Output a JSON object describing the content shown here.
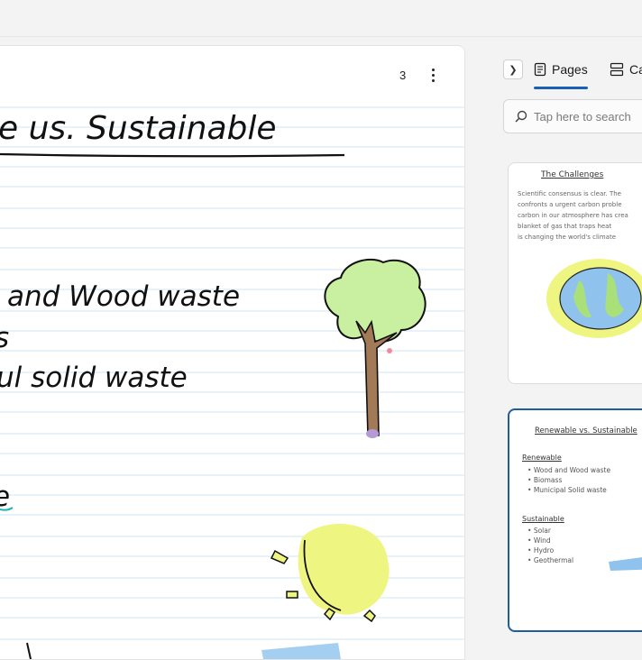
{
  "page": {
    "heading": "e us. Sustainable",
    "lines": [
      "and Wood waste",
      "s",
      "ul solid waste",
      "e"
    ],
    "page_count": "3"
  },
  "panel": {
    "tabs": [
      {
        "label": "Pages"
      },
      {
        "label": "Ca"
      }
    ],
    "search_placeholder": "Tap here to search"
  },
  "thumbnails": [
    {
      "title": "The Challenges",
      "body": [
        "Scientific consensus is clear. The",
        "confronts a urgent carbon proble",
        "carbon in our atmosphere has crea",
        "blanket of gas that traps heat",
        "is changing the world's climate"
      ]
    },
    {
      "title": "Renewable vs. Sustainable",
      "sections": [
        {
          "heading": "Renewable",
          "items": [
            "Wood and Wood waste",
            "Biomass",
            "Municipal Solid waste"
          ]
        },
        {
          "heading": "Sustainable",
          "items": [
            "Solar",
            "Wind",
            "Hydro",
            "Geothermal"
          ]
        }
      ]
    }
  ],
  "colors": {
    "accent": "#1a5fb4",
    "rule_line": "#d9e9f7",
    "tree_foliage": "#c8f0a0",
    "tree_trunk": "#a37a57",
    "sun": "#eef580",
    "earth_ocean": "#8fc3ee",
    "earth_land": "#a9e07a",
    "marker_teal": "#1fb5ad"
  }
}
